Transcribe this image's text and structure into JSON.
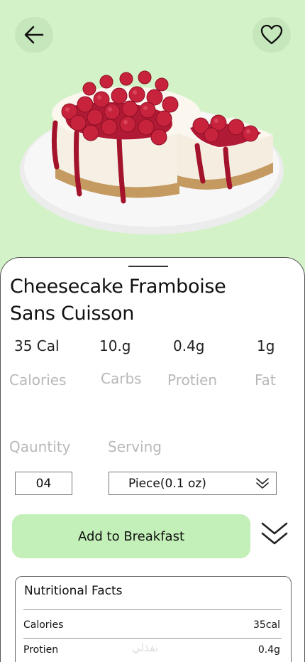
{
  "food": {
    "title_line1": "Cheesecake Framboise",
    "title_line2": "Sans Cuisson"
  },
  "nutrition": [
    {
      "value": "35 Cal",
      "label": "Calories"
    },
    {
      "value": "10.g",
      "label": "Carbs"
    },
    {
      "value": "0.4g",
      "label": "Protien"
    },
    {
      "value": "1g",
      "label": "Fat"
    }
  ],
  "quantity": {
    "label": "Qauntity",
    "value": "04"
  },
  "serving": {
    "label": "Serving",
    "value": "Piece(0.1 oz)"
  },
  "actions": {
    "add_label": "Add to Breakfast"
  },
  "facts": {
    "title": "Nutritional Facts",
    "rows": [
      {
        "name": "Calories",
        "value": "35cal"
      },
      {
        "name": "Protien",
        "value": "0.4g"
      }
    ]
  },
  "watermark": "نفذلي",
  "icons": {
    "back": "arrow-left-icon",
    "favorite": "heart-icon",
    "dropdown": "double-chevron-down-icon"
  },
  "colors": {
    "background": "#d3f2c8",
    "button": "#c3efb8",
    "muted_text": "#b8b8b8"
  }
}
